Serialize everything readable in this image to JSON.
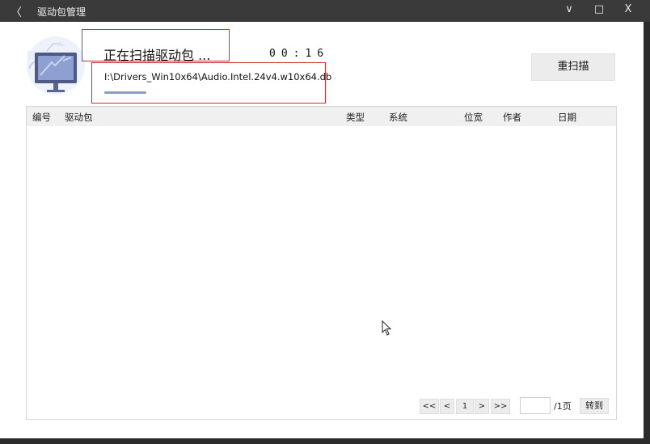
{
  "titlebar": {
    "back_glyph": "〈",
    "title": "驱动包管理",
    "minimize": "∨",
    "maximize": "□",
    "close": "X"
  },
  "scan": {
    "status": "正在扫描驱动包 ...",
    "timer": "00:16",
    "current_path": "I:\\Drivers_Win10x64\\Audio.Intel.24v4.w10x64.db",
    "progress": 0.18,
    "rescan_label": "重扫描"
  },
  "table": {
    "columns": [
      "编号",
      "驱动包",
      "类型",
      "系统",
      "位宽",
      "作者",
      "日期"
    ],
    "rows": []
  },
  "pagination": {
    "first": "<<",
    "prev": "<",
    "current_page": "1",
    "next": ">",
    "last": ">>",
    "page_input": "",
    "total": "/1页",
    "goto_label": "转到"
  },
  "colors": {
    "highlight_border": "#d92b2b",
    "progress_fill": "#8e9bc4"
  }
}
